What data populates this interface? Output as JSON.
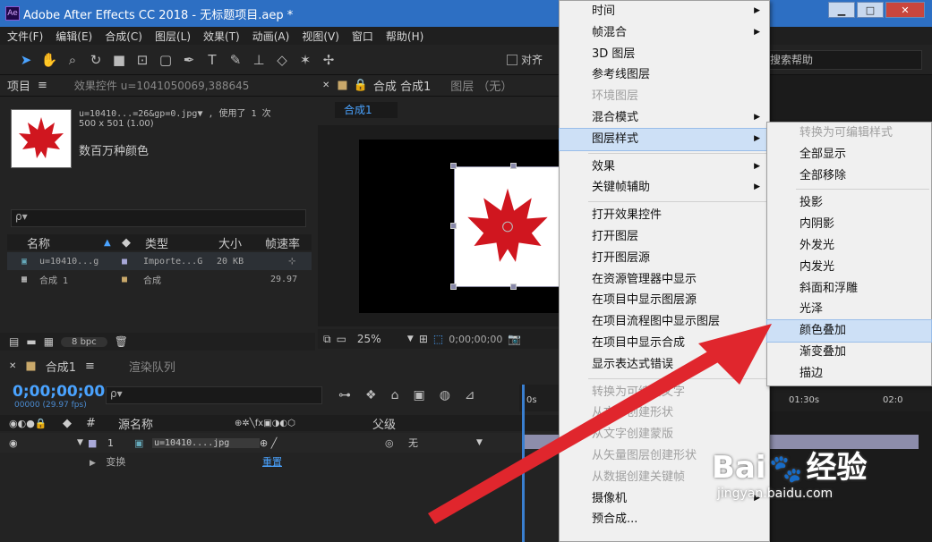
{
  "window": {
    "app_abbr": "Ae",
    "title": "Adobe After Effects CC 2018 - 无标题项目.aep *",
    "min": "▁",
    "max": "□",
    "close": "✕"
  },
  "menubar": [
    "文件(F)",
    "编辑(E)",
    "合成(C)",
    "图层(L)",
    "效果(T)",
    "动画(A)",
    "视图(V)",
    "窗口",
    "帮助(H)"
  ],
  "toolbar": {
    "snap_label": "对齐",
    "search_help": "搜索帮助"
  },
  "project": {
    "tab": "项目",
    "effect_tab": "效果控件 u=1041050069,388645",
    "item_name": "u=10410...=26&gp=0.jpg▼ , 使用了 1 次",
    "item_size": "500 x 501 (1.00)",
    "item_color": "数百万种颜色",
    "search_placeholder": "ρ▾",
    "cols": [
      "名称",
      "类型",
      "大小",
      "帧速率"
    ],
    "rows": [
      {
        "name": "u=10410...g",
        "type": "Importe...G",
        "size": "20 KB",
        "fps": ""
      },
      {
        "name": "合成 1",
        "type": "合成",
        "size": "",
        "fps": "29.97"
      }
    ],
    "bpc": "8 bpc"
  },
  "comp": {
    "tab": "合成 合成1",
    "layer_tab": "图层 （无）",
    "subtab": "合成1",
    "zoom": "25%",
    "time": "0;00;00;00"
  },
  "timeline": {
    "tab": "合成1",
    "render_tab": "渲染队列",
    "timecode": "0;00;00;00",
    "fps": "00000 (29.97 fps)",
    "search_placeholder": "ρ▾",
    "cols": {
      "num": "#",
      "source": "源名称",
      "parent": "父级"
    },
    "layer": {
      "num": "1",
      "name": "u=10410....jpg",
      "parent": "无"
    },
    "transform": "变换",
    "reset": "重置",
    "ruler": [
      "0s",
      "01:30s",
      "02:0"
    ]
  },
  "context_menu": [
    {
      "label": "时间",
      "sub": true
    },
    {
      "label": "帧混合",
      "sub": true
    },
    {
      "label": "3D 图层"
    },
    {
      "label": "参考线图层"
    },
    {
      "label": "环境图层",
      "disabled": true
    },
    {
      "label": "混合模式",
      "sub": true
    },
    {
      "label": "图层样式",
      "sub": true,
      "highlight": true
    },
    {
      "sep": true
    },
    {
      "label": "效果",
      "sub": true
    },
    {
      "label": "关键帧辅助",
      "sub": true
    },
    {
      "sep": true
    },
    {
      "label": "打开效果控件"
    },
    {
      "label": "打开图层"
    },
    {
      "label": "打开图层源"
    },
    {
      "label": "在资源管理器中显示"
    },
    {
      "label": "在项目中显示图层源"
    },
    {
      "label": "在项目流程图中显示图层"
    },
    {
      "label": "在项目中显示合成"
    },
    {
      "label": "显示表达式错误"
    },
    {
      "sep": true
    },
    {
      "label": "转换为可编辑文字",
      "disabled": true
    },
    {
      "label": "从文字创建形状",
      "disabled": true
    },
    {
      "label": "从文字创建蒙版",
      "disabled": true
    },
    {
      "label": "从矢量图层创建形状",
      "disabled": true
    },
    {
      "label": "从数据创建关键帧",
      "disabled": true
    },
    {
      "label": "摄像机",
      "sub": true
    },
    {
      "label": "预合成..."
    }
  ],
  "submenu": [
    {
      "label": "转换为可编辑样式",
      "disabled": true
    },
    {
      "label": "全部显示"
    },
    {
      "label": "全部移除"
    },
    {
      "sep": true
    },
    {
      "label": "投影"
    },
    {
      "label": "内阴影"
    },
    {
      "label": "外发光"
    },
    {
      "label": "内发光"
    },
    {
      "label": "斜面和浮雕"
    },
    {
      "label": "光泽"
    },
    {
      "label": "颜色叠加",
      "highlight": true
    },
    {
      "label": "渐变叠加"
    },
    {
      "label": "描边"
    }
  ],
  "watermark": {
    "brand": "Bai",
    "brand2": "经验",
    "url": "jingyan.baidu.com"
  },
  "colors": {
    "accent": "#4aa3ff",
    "arrow": "#e0262d",
    "titlebar": "#2d6fc3"
  }
}
